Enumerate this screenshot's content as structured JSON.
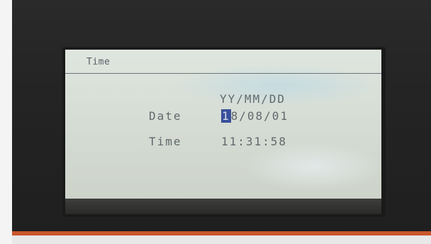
{
  "screen": {
    "title": "Time",
    "format_label": "YY/MM/DD",
    "date": {
      "label": "Date",
      "cursor_char": "1",
      "rest": "8/08/01"
    },
    "time": {
      "label": "Time",
      "value": "11:31:58"
    }
  },
  "colors": {
    "lcd_background": "#d9e0d8",
    "lcd_text": "#61696d",
    "cursor_highlight": "#3a4f9a",
    "bezel": "#242424",
    "accent_strip": "#c9562c"
  }
}
